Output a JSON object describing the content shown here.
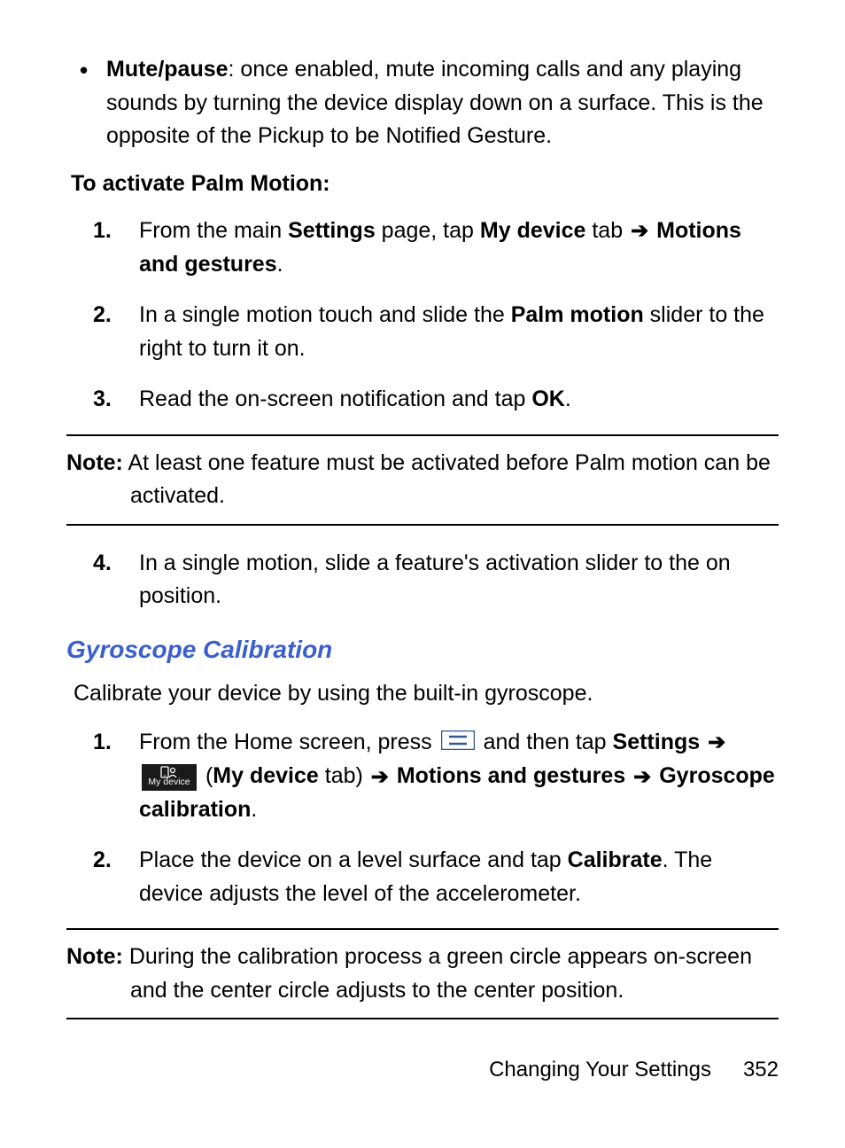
{
  "bulletItem": {
    "boldPrefix": "Mute/pause",
    "rest": ": once enabled, mute incoming calls and any playing sounds by turning the device display down on a surface. This is the opposite of the Pickup to be Notified Gesture."
  },
  "activateHeading": "To activate Palm Motion:",
  "steps1": {
    "n1": {
      "num": "1.",
      "t1": "From the main ",
      "b1": "Settings",
      "t2": " page, tap ",
      "b2": "My device",
      "t3": " tab ",
      "b3": "Motions and gestures",
      "t4": "."
    },
    "n2": {
      "num": "2.",
      "t1": "In a single motion touch and slide the ",
      "b1": "Palm motion",
      "t2": " slider to the right to turn it on."
    },
    "n3": {
      "num": "3.",
      "t1": "Read the on-screen notification and tap ",
      "b1": "OK",
      "t2": "."
    }
  },
  "note1": {
    "bold": "Note:",
    "text": " At least one feature must be activated before Palm motion can be activated."
  },
  "step4": {
    "num": "4.",
    "text": "In a single motion, slide a feature's activation slider to the on position."
  },
  "gyroHeading": "Gyroscope Calibration",
  "gyroIntro": "Calibrate your device by using the built-in gyroscope.",
  "gyroSteps": {
    "n1": {
      "num": "1.",
      "t1": "From the Home screen, press ",
      "t2": " and then tap ",
      "b1": "Settings",
      "t3": " (",
      "b2": "My device",
      "t4": " tab) ",
      "b3": "Motions and gestures",
      "b4": "Gyroscope calibration",
      "t5": ".",
      "iconLabel": "My device"
    },
    "n2": {
      "num": "2.",
      "t1": "Place the device on a level surface and tap ",
      "b1": "Calibrate",
      "t2": ". The device adjusts the level of the accelerometer."
    }
  },
  "note2": {
    "bold": "Note:",
    "text": " During the calibration process a green circle appears on-screen and the center circle adjusts to the center position."
  },
  "footer": {
    "section": "Changing Your Settings",
    "page": "352"
  }
}
